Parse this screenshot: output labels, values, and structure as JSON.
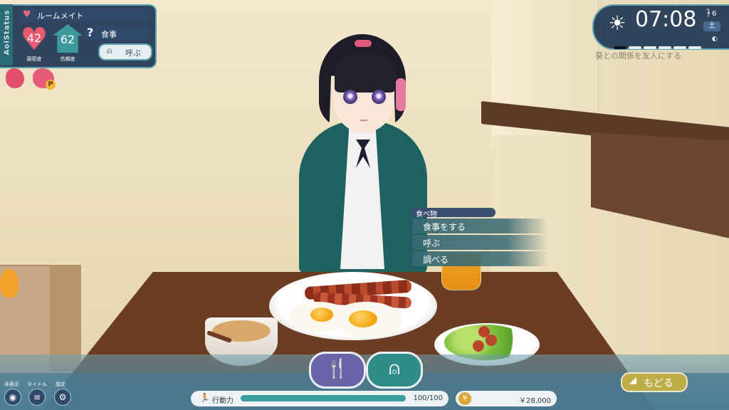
{
  "status": {
    "tab_label": "AoiStatus",
    "relation_label": "ルームメイト",
    "affection_value": "42",
    "affection_label": "親密度",
    "trust_value": "62",
    "trust_label": "信頼度",
    "need_icon": "?",
    "need_text": "食事",
    "call_label": "呼ぶ"
  },
  "clock": {
    "time": "07:08",
    "month": "1",
    "day": "6",
    "weekday": "土",
    "time_blocks_filled": 1,
    "time_blocks_total": 6,
    "goal": "葵との関係を友人にする"
  },
  "menu": {
    "header": "食べ物",
    "items": [
      "食事をする",
      "呼ぶ",
      "調べる"
    ]
  },
  "bottom": {
    "hide_label": "非表示",
    "title_label": "タイトル",
    "settings_label": "設定",
    "action_label": "行動力",
    "action_value": "100/100",
    "action_fraction": 1.0,
    "money_value": "￥28,000",
    "coin_symbol": "¥",
    "back_label": "もどる"
  },
  "icons": {
    "heart": "heart-icon",
    "sun": "sun-icon",
    "bell": "service-bell-icon",
    "eat": "fork-spoon-icon",
    "eye": "eye-icon",
    "menu": "menu-icon",
    "gear": "gear-icon",
    "runner": "runner-icon",
    "back": "back-arrow-icon"
  },
  "colors": {
    "panel": "#1f3754",
    "accent": "#5fa7b0",
    "affection": "#e85a6f",
    "trust": "#3c9a9c",
    "back": "#bfae47"
  }
}
